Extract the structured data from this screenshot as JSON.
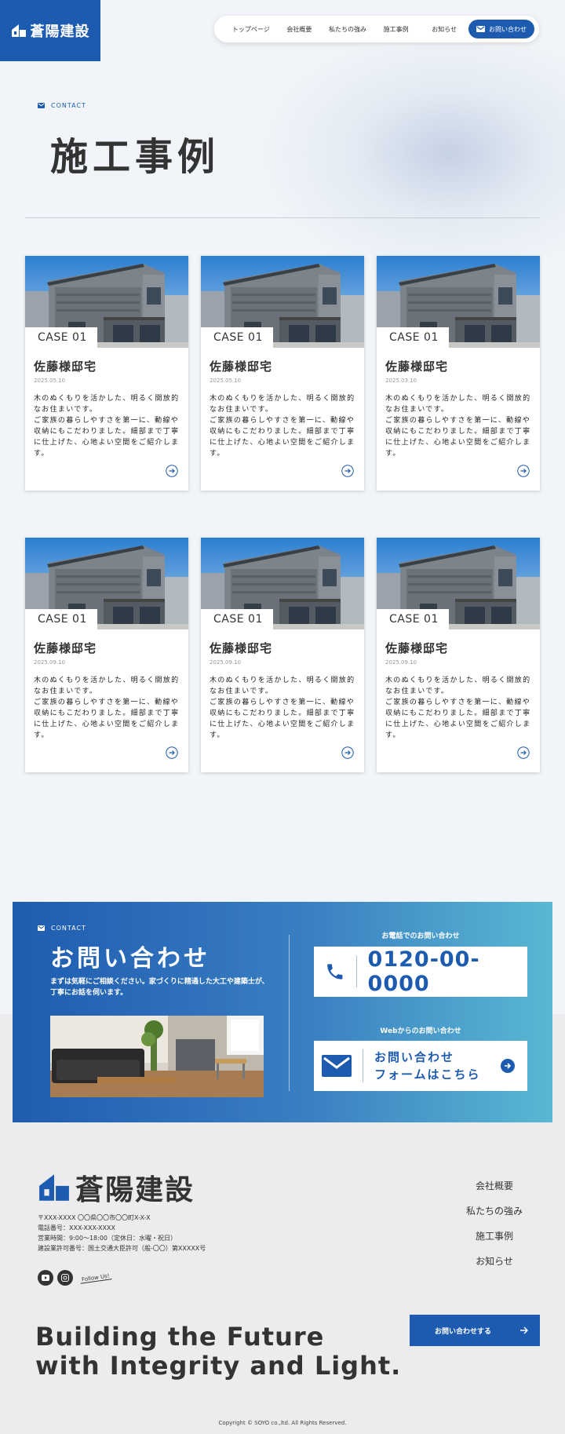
{
  "brand": {
    "name": "蒼陽建設",
    "color": "#1d5bb0"
  },
  "nav": {
    "items": [
      "トップページ",
      "会社概要",
      "私たちの強み",
      "施工事例",
      "お知らせ"
    ],
    "contact_label": "お問い合わせ"
  },
  "hero": {
    "eyebrow": "CONTACT",
    "title": "施工事例"
  },
  "cases": [
    {
      "case": "CASE 01",
      "title": "佐藤様邸宅",
      "date": "2025.05.10",
      "desc": "木のぬくもりを活かした、明るく開放的なお住まいです。\nご家族の暮らしやすさを第一に、動線や収納にもこだわりました。細部まで丁寧に仕上げた、心地よい空間をご紹介します。"
    },
    {
      "case": "CASE 01",
      "title": "佐藤様邸宅",
      "date": "2025.05.10",
      "desc": "木のぬくもりを活かした、明るく開放的なお住まいです。\nご家族の暮らしやすさを第一に、動線や収納にもこだわりました。細部まで丁寧に仕上げた、心地よい空間をご紹介します。"
    },
    {
      "case": "CASE 01",
      "title": "佐藤様邸宅",
      "date": "2025.03.10",
      "desc": "木のぬくもりを活かした、明るく開放的なお住まいです。\nご家族の暮らしやすさを第一に、動線や収納にもこだわりました。細部まで丁寧に仕上げた、心地よい空間をご紹介します。"
    },
    {
      "case": "CASE 01",
      "title": "佐藤様邸宅",
      "date": "2025.09.10",
      "desc": "木のぬくもりを活かした、明るく開放的なお住まいです。\nご家族の暮らしやすさを第一に、動線や収納にもこだわりました。細部まで丁寧に仕上げた、心地よい空間をご紹介します。"
    },
    {
      "case": "CASE 01",
      "title": "佐藤様邸宅",
      "date": "2025.09.10",
      "desc": "木のぬくもりを活かした、明るく開放的なお住まいです。\nご家族の暮らしやすさを第一に、動線や収納にもこだわりました。細部まで丁寧に仕上げた、心地よい空間をご紹介します。"
    },
    {
      "case": "CASE 01",
      "title": "佐藤様邸宅",
      "date": "2025.09.10",
      "desc": "木のぬくもりを活かした、明るく開放的なお住まいです。\nご家族の暮らしやすさを第一に、動線や収納にもこだわりました。細部まで丁寧に仕上げた、心地よい空間をご紹介します。"
    }
  ],
  "contact": {
    "eyebrow": "CONTACT",
    "title": "お問い合わせ",
    "desc": "まずは気軽にご相談ください。家づくりに精通した大工や建築士が、丁寧にお話を伺います。",
    "phone_label": "お電話でのお問い合わせ",
    "phone_number": "0120-00-0000",
    "web_label": "Webからのお問い合わせ",
    "web_line1": "お問い合わせ",
    "web_line2": "フォームはこちら"
  },
  "footer": {
    "logo_text": "蒼陽建設",
    "address": "〒XXX-XXXX 〇〇県〇〇市〇〇町X-X-X",
    "phone": "電話番号：XXX-XXX-XXXX",
    "hours": "営業時間：9:00〜18:00（定休日：水曜・祝日）",
    "license": "建設業許可番号：国土交通大臣許可（般-〇〇）第XXXXX号",
    "follow": "Follow Us!",
    "nav": [
      "会社概要",
      "私たちの強み",
      "施工事例",
      "お知らせ"
    ],
    "cta_label": "お問い合わせする",
    "tagline_line1": "Building the Future",
    "tagline_line2": "with Integrity and Light.",
    "copyright": "Copyright © SOYO co.,ltd. All Rights Reserved."
  },
  "icons": [
    "house-logo-icon",
    "mail-icon",
    "arrow-circle-icon",
    "phone-icon",
    "youtube-icon",
    "instagram-icon",
    "arrow-right-icon"
  ]
}
